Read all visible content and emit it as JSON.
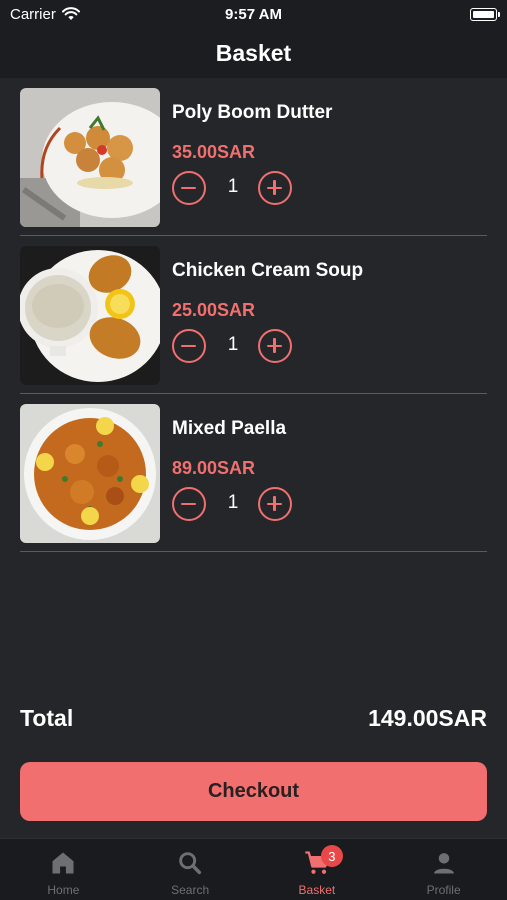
{
  "status_bar": {
    "carrier": "Carrier",
    "time": "9:57 AM"
  },
  "header": {
    "title": "Basket"
  },
  "items": [
    {
      "name": "Poly Boom Dutter",
      "price": "35.00SAR",
      "quantity": "1"
    },
    {
      "name": "Chicken Cream Soup",
      "price": "25.00SAR",
      "quantity": "1"
    },
    {
      "name": "Mixed Paella",
      "price": "89.00SAR",
      "quantity": "1"
    }
  ],
  "summary": {
    "total_label": "Total",
    "total_value": "149.00SAR"
  },
  "checkout_label": "Checkout",
  "tabs": [
    {
      "label": "Home",
      "icon": "home-icon"
    },
    {
      "label": "Search",
      "icon": "search-icon"
    },
    {
      "label": "Basket",
      "icon": "cart-icon",
      "badge": "3",
      "active": true
    },
    {
      "label": "Profile",
      "icon": "person-icon"
    }
  ],
  "colors": {
    "accent": "#f07070",
    "background": "#25262a",
    "button": "#f26f6f",
    "badge": "#e84848"
  }
}
